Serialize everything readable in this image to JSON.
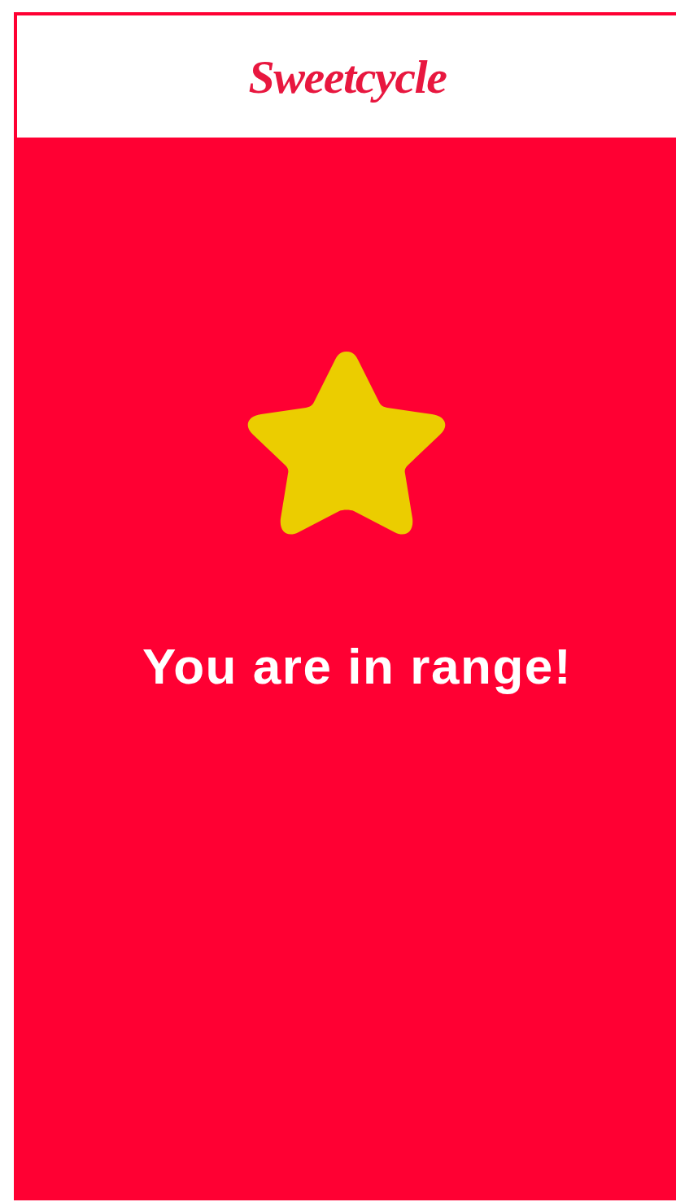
{
  "header": {
    "title": "Sweetcycle"
  },
  "status": {
    "message": "You are in range!"
  }
}
